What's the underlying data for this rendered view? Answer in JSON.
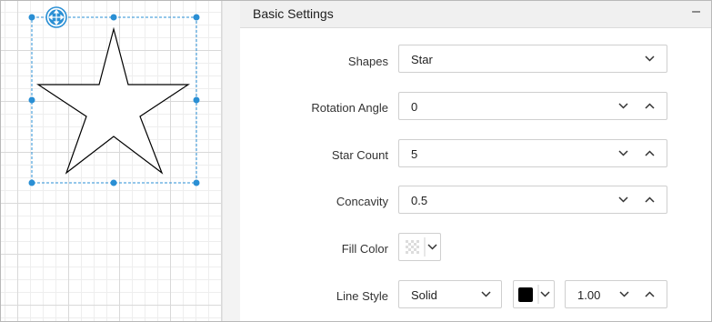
{
  "panel": {
    "title": "Basic Settings",
    "collapse_icon": "minus-icon"
  },
  "properties": {
    "shapes": {
      "label": "Shapes",
      "value": "Star"
    },
    "rotation_angle": {
      "label": "Rotation Angle",
      "value": "0"
    },
    "star_count": {
      "label": "Star Count",
      "value": "5"
    },
    "concavity": {
      "label": "Concavity",
      "value": "0.5"
    },
    "fill_color": {
      "label": "Fill Color",
      "value": "transparent"
    },
    "line_style": {
      "label": "Line Style",
      "style": "Solid",
      "color": "#000000",
      "width": "1.00"
    }
  },
  "colors": {
    "selection": "#2a8fd4",
    "header_bg": "#f0f0f0"
  }
}
